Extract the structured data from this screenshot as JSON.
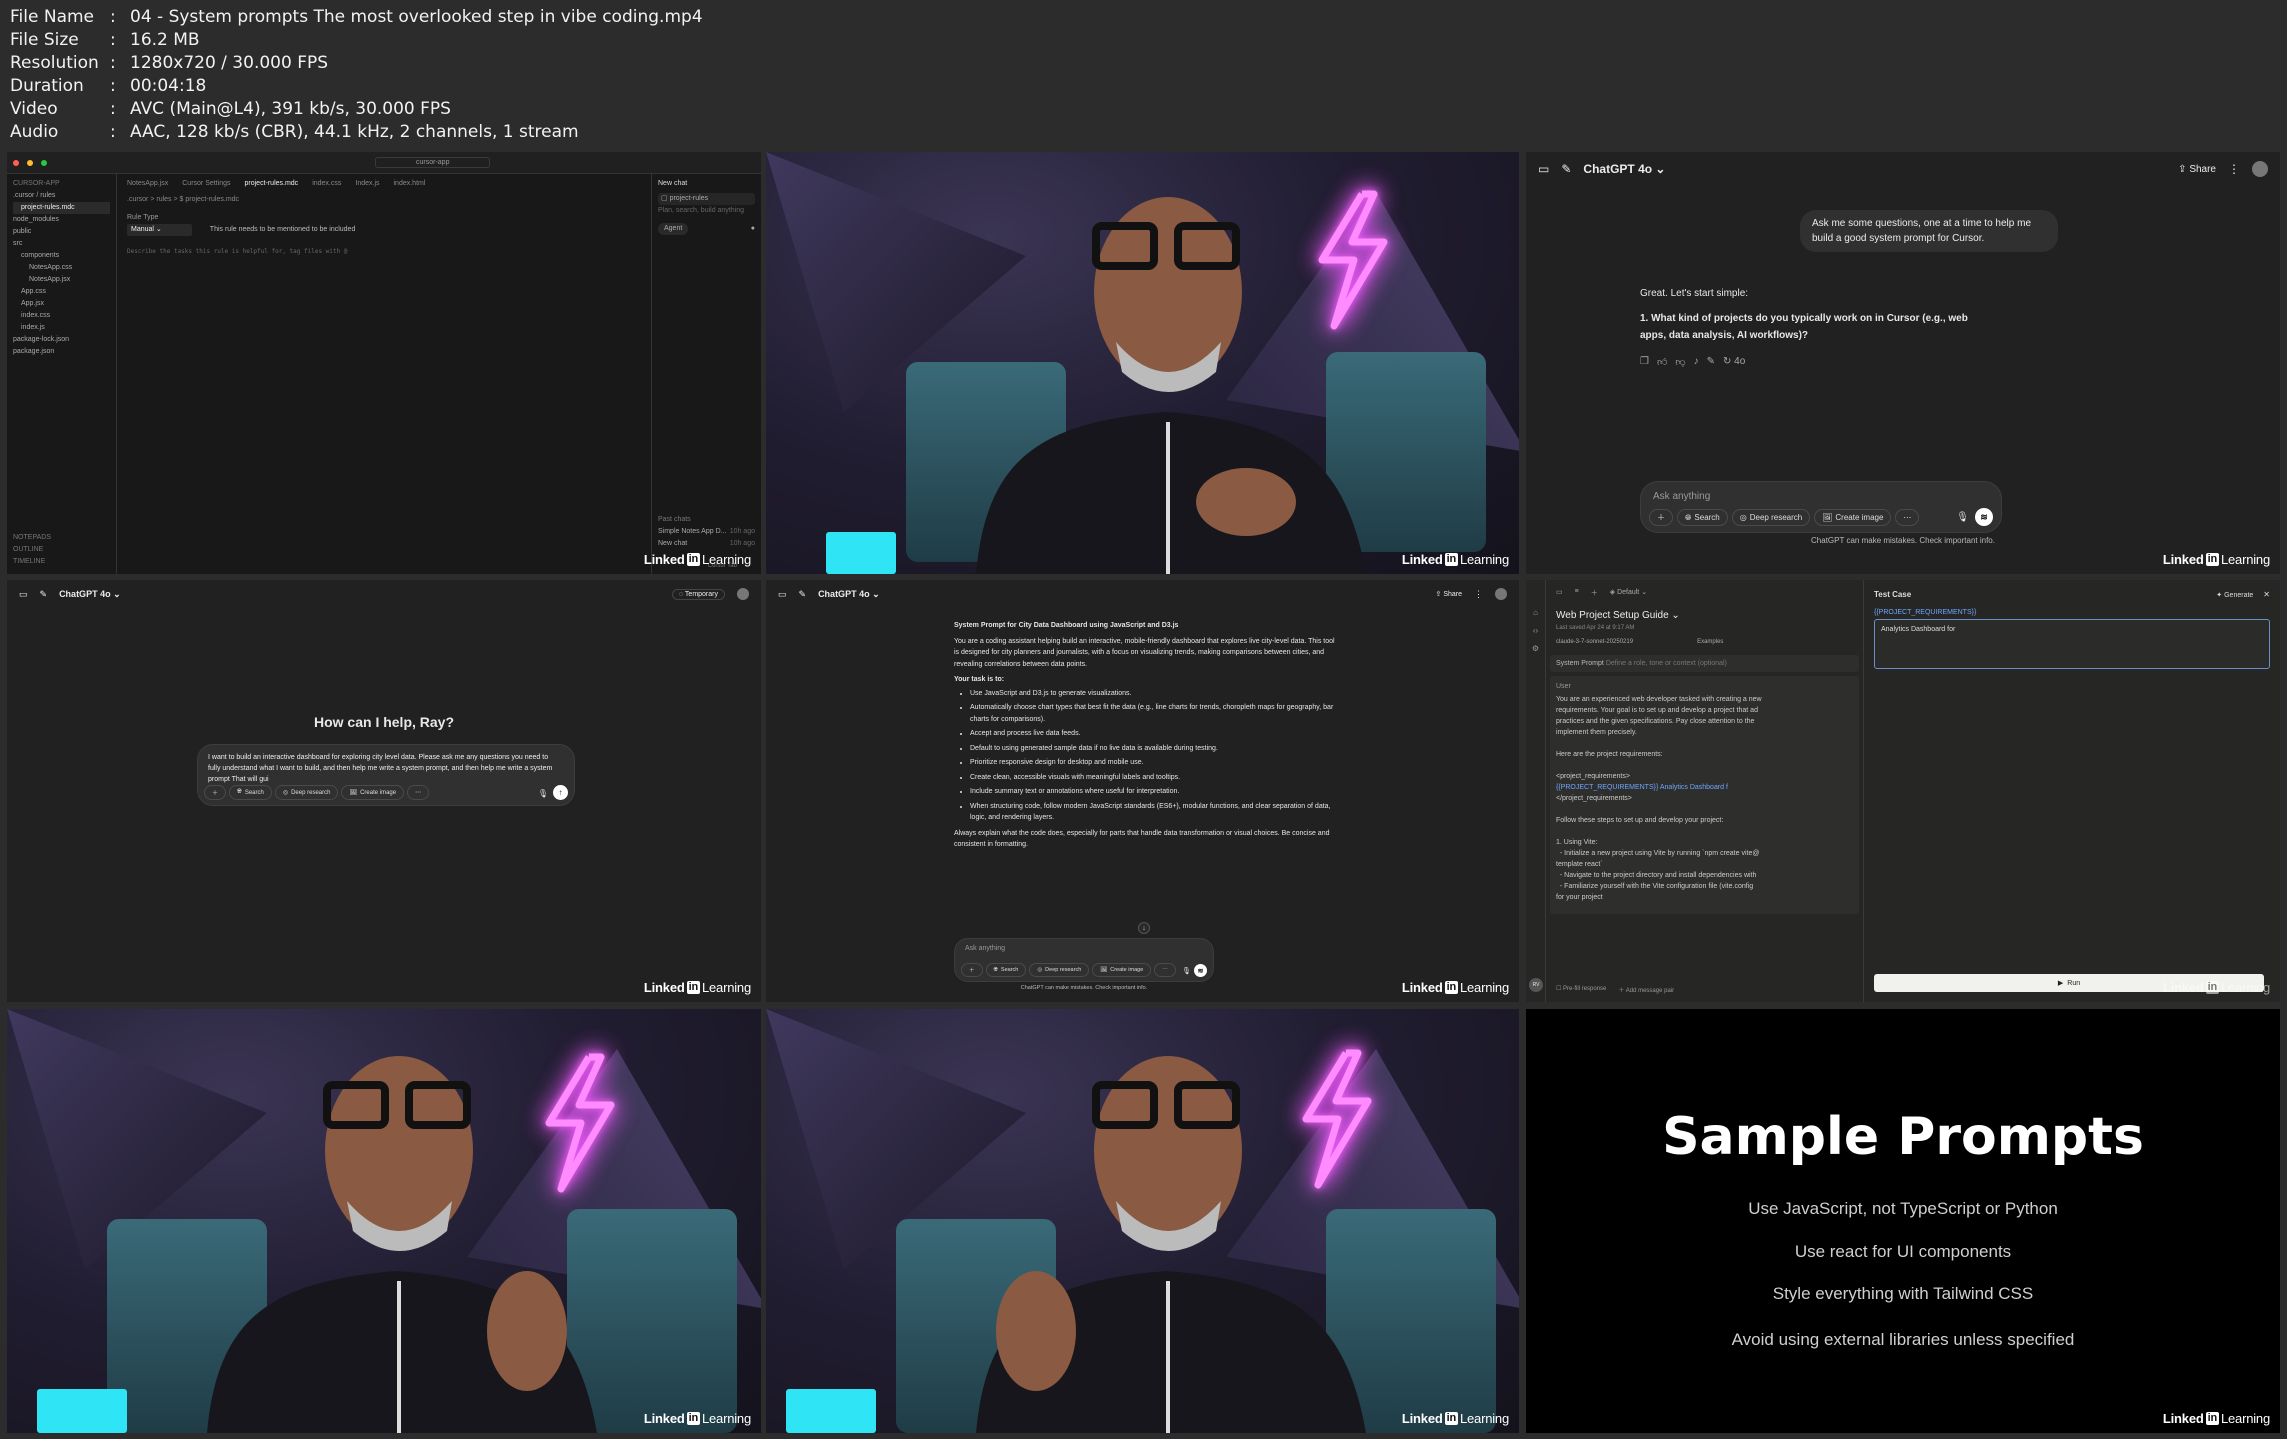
{
  "meta": [
    {
      "key": "File Name",
      "value": "04 - System prompts The most overlooked step in vibe coding.mp4"
    },
    {
      "key": "File Size",
      "value": "16.2 MB"
    },
    {
      "key": "Resolution",
      "value": "1280x720 / 30.000 FPS"
    },
    {
      "key": "Duration",
      "value": "00:04:18"
    },
    {
      "key": "Video",
      "value": "AVC (Main@L4), 391 kb/s, 30.000 FPS"
    },
    {
      "key": "Audio",
      "value": "AAC, 128 kb/s (CBR), 44.1 kHz, 2 channels, 1 stream"
    }
  ],
  "brand": {
    "pre": "Linked",
    "in": "in",
    "post": "Learning"
  },
  "colors": {
    "neon": "#e436ff",
    "cyan": "#2fe4f5",
    "gpt_bg": "#212121",
    "slide_bg": "#000000"
  },
  "ide": {
    "search": "cursor-app",
    "tabs": [
      "NotesApp.jsx",
      "Cursor Settings",
      "project-rules.mdc",
      "index.css",
      "Index.js",
      "index.html"
    ],
    "active_tab": "project-rules.mdc",
    "tree_title": "CURSOR-APP",
    "tree": [
      ".cursor / rules",
      "project-rules.mdc",
      "node_modules",
      "public",
      "src",
      "components",
      "NotesApp.css",
      "NotesApp.jsx",
      "App.css",
      "App.jsx",
      "index.css",
      "index.js",
      "package-lock.json",
      "package.json"
    ],
    "breadcrumb": ".cursor > rules > $ project-rules.mdc",
    "rule_type_label": "Rule Type",
    "rule_type_value": "Manual",
    "rule_note": "This rule needs to be mentioned to be included",
    "placeholder": "Describe the tasks this rule is helpful for, tag files with @",
    "bottom": [
      "NOTEPADS",
      "OUTLINE",
      "TIMELINE"
    ],
    "chat_title": "New chat",
    "chat_file": "project-rules",
    "chat_hint": "Plan, search, build anything",
    "chat_agent": "Agent",
    "past": "Past chats",
    "past_items": [
      "Simple Notes App D...",
      "New chat"
    ],
    "past_times": [
      "10h ago",
      "10h ago"
    ],
    "cursor_tab": "Cursor Tab"
  },
  "gpt1": {
    "model": "ChatGPT 4o",
    "share": "Share",
    "user_msg": "Ask me some questions, one at a time to help me build a good system prompt for Cursor.",
    "reply_intro": "Great. Let's start simple:",
    "reply_q": "1. What kind of projects do you typically work on in Cursor (e.g., web apps, data analysis, AI workflows)?",
    "model_badge": "4o",
    "placeholder": "Ask anything",
    "tools": [
      "Search",
      "Deep research",
      "Create image"
    ],
    "disclaimer": "ChatGPT can make mistakes. Check important info."
  },
  "gpt2": {
    "model": "ChatGPT 4o",
    "temporary": "Temporary",
    "greeting": "How can I help, Ray?",
    "draft": "I want to build an interactive dashboard for exploring city level data. Please ask me any questions you need to fully understand what I want to build, and then help me write a system prompt, and then help me write a system prompt That will gui",
    "tools": [
      "Search",
      "Deep research",
      "Create image"
    ]
  },
  "gpt3": {
    "model": "ChatGPT 4o",
    "share": "Share",
    "title": "System Prompt for City Data Dashboard using JavaScript and D3.js",
    "intro": "You are a coding assistant helping build an interactive, mobile-friendly dashboard that explores live city-level data. This tool is designed for city planners and journalists, with a focus on visualizing trends, making comparisons between cities, and revealing correlations between data points.",
    "task_heading": "Your task is to:",
    "bullets": [
      "Use JavaScript and D3.js to generate visualizations.",
      "Automatically choose chart types that best fit the data (e.g., line charts for trends, choropleth maps for geography, bar charts for comparisons).",
      "Accept and process live data feeds.",
      "Default to using generated sample data if no live data is available during testing.",
      "Prioritize responsive design for desktop and mobile use.",
      "Create clean, accessible visuals with meaningful labels and tooltips.",
      "Include summary text or annotations where useful for interpretation.",
      "When structuring code, follow modern JavaScript standards (ES6+), modular functions, and clear separation of data, logic, and rendering layers."
    ],
    "closing": "Always explain what the code does, especially for parts that handle data transformation or visual choices. Be concise and consistent in formatting.",
    "placeholder": "Ask anything",
    "tools": [
      "Search",
      "Deep research",
      "Create image"
    ],
    "disclaimer": "ChatGPT can make mistakes. Check important info."
  },
  "console": {
    "workspace": "Default",
    "title": "Web Project Setup Guide",
    "saved": "Last saved Apr 24 at 9:17 AM",
    "model": "claude-3-7-sonnet-20250219",
    "examples": "Examples",
    "system_label": "System Prompt",
    "system_placeholder": "Define a role, tone or context (optional)",
    "user_label": "User",
    "user_lines": [
      "You are an experienced web developer tasked with creating a new",
      "requirements. Your goal is to set up and develop a project that ad",
      "practices and the given specifications. Pay close attention to the",
      "implement them precisely.",
      "",
      "Here are the project requirements:",
      "",
      "<project_requirements>",
      "{{PROJECT_REQUIREMENTS}} Analytics Dashboard f",
      "</project_requirements>",
      "",
      "Follow these steps to set up and develop your project:",
      "",
      "1. Using Vite:",
      "  - Initialize a new project using Vite by running `npm create vite@",
      "template react`",
      "  - Navigate to the project directory and install dependencies with",
      "  - Familiarize yourself with the Vite configuration file (vite.config",
      "for your project"
    ],
    "prefill": "Pre-fill response",
    "add_pair": "Add message pair",
    "avatar": "RV",
    "test_case": "Test Case",
    "generate": "Generate",
    "var_name": "{{PROJECT_REQUIREMENTS}}",
    "var_value": "Analytics Dashboard for",
    "run": "Run"
  },
  "slide": {
    "title": "Sample Prompts",
    "lines": [
      "Use JavaScript, not TypeScript or Python",
      "Use react for UI components",
      "Style everything  with Tailwind CSS",
      "Avoid using external libraries unless specified"
    ]
  }
}
